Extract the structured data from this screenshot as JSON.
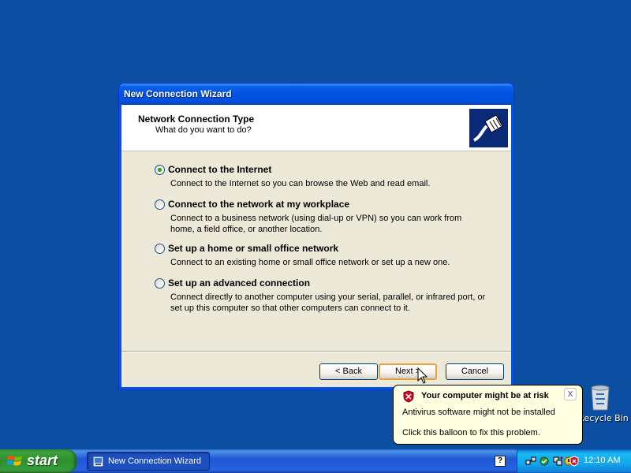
{
  "window": {
    "title": "New Connection Wizard",
    "header_title": "Network Connection Type",
    "header_subtitle": "What do you want to do?",
    "options": [
      {
        "label": "Connect to the Internet",
        "description": "Connect to the Internet so you can browse the Web and read email.",
        "checked": true
      },
      {
        "label": "Connect to the network at my workplace",
        "description": "Connect to a business network (using dial-up or VPN) so you can work from home, a field office, or another location.",
        "checked": false
      },
      {
        "label": "Set up a home or small office network",
        "description": "Connect to an existing home or small office network or set up a new one.",
        "checked": false
      },
      {
        "label": "Set up an advanced connection",
        "description": "Connect directly to another computer using your serial, parallel, or infrared port, or set up this computer so that other computers can connect to it.",
        "checked": false
      }
    ],
    "buttons": {
      "back": "< Back",
      "next": "Next >",
      "cancel": "Cancel"
    }
  },
  "desktop": {
    "recycle_bin_label": "Recycle Bin",
    "background_color": "#0b4ea2"
  },
  "balloon": {
    "title": "Your computer might be at risk",
    "line1": "Antivirus software might not be installed",
    "line2": "Click this balloon to fix this problem.",
    "close_label": "x"
  },
  "taskbar": {
    "start_label": "start",
    "task_button_label": "New Connection Wizard",
    "help_label": "?",
    "clock": "12:10 AM",
    "tray_icons": [
      "network-icon",
      "security-icon",
      "network-activity-icon",
      "update-icon",
      "security-alert-icon"
    ]
  }
}
